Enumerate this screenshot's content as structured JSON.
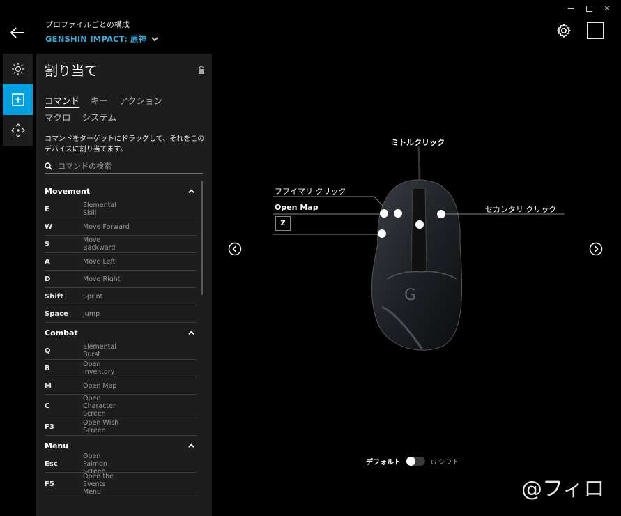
{
  "header": {
    "subtitle": "プロファイルごとの構成",
    "profile": "GENSHIN IMPACT: 原神"
  },
  "panel": {
    "title": "割り当て",
    "tabs": [
      "コマンド",
      "キー",
      "アクション",
      "マクロ",
      "システム"
    ],
    "description": "コマンドをターゲットにドラッグして、それをこのデバイスに割り当てます。",
    "search_placeholder": "コマンドの検索"
  },
  "sections": [
    {
      "name": "Movement",
      "rows": [
        {
          "key": "E",
          "cmd": "Elemental Skill"
        },
        {
          "key": "W",
          "cmd": "Move Forward"
        },
        {
          "key": "S",
          "cmd": "Move Backward"
        },
        {
          "key": "A",
          "cmd": "Move Left"
        },
        {
          "key": "D",
          "cmd": "Move Right"
        },
        {
          "key": "Shift",
          "cmd": "Sprint"
        },
        {
          "key": "Space",
          "cmd": "Jump"
        }
      ]
    },
    {
      "name": "Combat",
      "rows": [
        {
          "key": "Q",
          "cmd": "Elemental Burst"
        },
        {
          "key": "B",
          "cmd": "Open Inventory"
        },
        {
          "key": "M",
          "cmd": "Open Map"
        },
        {
          "key": "C",
          "cmd": "Open Character Screen"
        },
        {
          "key": "F3",
          "cmd": "Open Wish Screen"
        }
      ]
    },
    {
      "name": "Menu",
      "rows": [
        {
          "key": "Esc",
          "cmd": "Open Paimon Screen"
        },
        {
          "key": "F5",
          "cmd": "Open the Events Menu"
        }
      ]
    }
  ],
  "mouse": {
    "middle_click": "ミトルクリック",
    "primary_click": "フフイマリ クリック",
    "secondary_click": "セカンタリ クリック",
    "side_assignment": "Open Map",
    "side_key": "Z"
  },
  "toggle": {
    "left": "デフォルト",
    "right": "G シフト"
  },
  "watermark": "@フィロ"
}
